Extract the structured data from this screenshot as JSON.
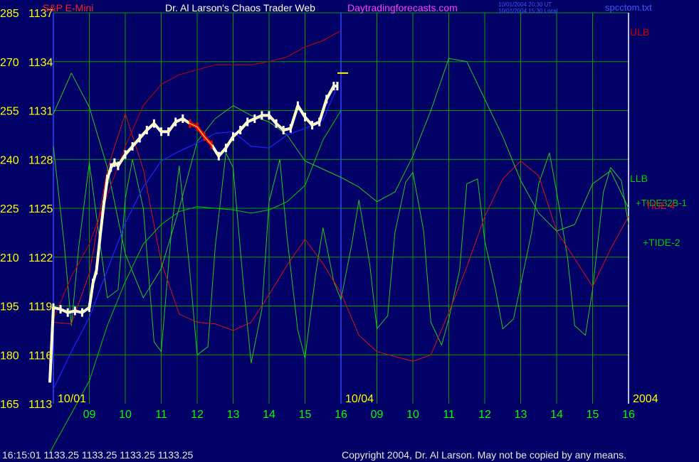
{
  "header": {
    "instrument": "S&P E-Mini",
    "site_title": "Dr. Al Larson's Chaos Trader Web",
    "site_url": "Daytradingforecasts.com",
    "ut_time": "10/01/2004 20:30 UT",
    "local_time": "10/01/2004 15:30 Local",
    "file_name": "spcctom.txt"
  },
  "footer": {
    "quote": "16:15:01  1133.25 1133.25 1133.25 1133.25",
    "copyright": "Copyright 2004, Dr. Al Larson. May not be copied by any means."
  },
  "colors": {
    "background": "#000066",
    "grid": "#00a000",
    "axis_text": "#ffff00",
    "time_text": "#00ff00",
    "price_bars": "#ffffff",
    "red_bars": "#ff0000",
    "ulb": "#cc0000",
    "llb": "#00cc00",
    "tide_red": "#dd1111",
    "tide_green": "#22cc22",
    "moving_avg": "#2222ff"
  },
  "chart_data": {
    "type": "line",
    "title": "S&P E-Mini",
    "y_left_outer": {
      "ticks": [
        165,
        180,
        195,
        210,
        225,
        240,
        255,
        270,
        285
      ]
    },
    "y_left_inner": {
      "ticks": [
        1113,
        1116,
        1119,
        1122,
        1125,
        1128,
        1131,
        1134,
        1137
      ],
      "range": [
        1113,
        1137
      ]
    },
    "x_ticks": [
      "09",
      "10",
      "11",
      "12",
      "13",
      "14",
      "15",
      "16",
      "09",
      "10",
      "11",
      "12",
      "13",
      "14",
      "15",
      "16"
    ],
    "date_labels": [
      {
        "at_index": 0,
        "text": "10/01"
      },
      {
        "at_index": 8,
        "text": "10/04"
      },
      {
        "at_index": 16,
        "text": "2004"
      }
    ],
    "x_range": [
      0,
      16
    ],
    "current_price": 1133.25,
    "price_series": {
      "name": "S&P E-Mini",
      "x": [
        -0.1,
        0,
        0.2,
        0.4,
        0.6,
        0.8,
        1.0,
        1.1,
        1.2,
        1.3,
        1.4,
        1.5,
        1.6,
        1.7,
        1.8,
        2.0,
        2.2,
        2.4,
        2.6,
        2.8,
        3.0,
        3.2,
        3.4,
        3.6,
        3.8,
        4.0,
        4.2,
        4.4,
        4.6,
        4.8,
        5.0,
        5.2,
        5.4,
        5.6,
        5.8,
        6.0,
        6.2,
        6.4,
        6.6,
        6.8,
        7.0,
        7.2,
        7.4,
        7.6,
        7.8,
        7.9
      ],
      "y": [
        1114.3,
        1118.9,
        1118.8,
        1118.6,
        1118.7,
        1118.6,
        1118.9,
        1120.4,
        1121.2,
        1123.3,
        1125.2,
        1126.8,
        1127.5,
        1127.8,
        1127.6,
        1128.3,
        1128.8,
        1129.3,
        1129.8,
        1130.2,
        1129.7,
        1129.7,
        1130.3,
        1130.5,
        1130.2,
        1130.0,
        1129.4,
        1128.9,
        1128.2,
        1128.7,
        1129.4,
        1129.8,
        1130.3,
        1130.5,
        1130.7,
        1130.7,
        1130.2,
        1129.8,
        1129.9,
        1131.3,
        1130.6,
        1130.1,
        1130.3,
        1131.7,
        1132.5,
        1132.5
      ]
    },
    "red_segment_x": [
      3.7,
      4.4
    ],
    "forecast_stub": {
      "x": [
        7.9,
        8.2
      ],
      "y": [
        1133.3,
        1133.3
      ]
    },
    "ulb": {
      "name": "ULB",
      "x": [
        0,
        0.5,
        1.0,
        1.5,
        2.0,
        2.5,
        3.0,
        3.5,
        4.0,
        4.5,
        5.0,
        5.5,
        6.0,
        6.5,
        7.0,
        7.5,
        8.0
      ],
      "y": [
        1118.2,
        1120.8,
        1122.8,
        1125.8,
        1128.8,
        1131.3,
        1132.6,
        1133.2,
        1133.5,
        1133.8,
        1133.8,
        1133.8,
        1134.0,
        1134.3,
        1134.9,
        1135.3,
        1135.9
      ]
    },
    "llb": {
      "name": "LLB",
      "x": [
        -0.1,
        0.5,
        1.0,
        1.5,
        2.0,
        2.5,
        3.0,
        3.5,
        4.0,
        4.5,
        5.0,
        5.5,
        6.0,
        6.5,
        7.0,
        7.5,
        8.0
      ],
      "y": [
        1110.0,
        1112.4,
        1114.4,
        1117.8,
        1120.5,
        1122.8,
        1124.0,
        1124.8,
        1125.1,
        1125.0,
        1124.9,
        1124.7,
        1124.9,
        1125.4,
        1126.4,
        1129.2,
        1131.0
      ]
    },
    "moving_average": {
      "x": [
        0,
        0.5,
        1.0,
        1.5,
        2.0,
        2.5,
        3.0,
        3.5,
        4.0,
        4.5,
        5.0,
        5.5,
        6.0,
        6.5,
        7.0,
        7.5,
        7.9
      ],
      "y": [
        1113.9,
        1116.2,
        1118.3,
        1121.2,
        1124.1,
        1126.3,
        1127.9,
        1128.5,
        1129.0,
        1129.6,
        1129.7,
        1128.8,
        1128.7,
        1129.5,
        1129.9,
        1130.4,
        1132.5
      ]
    },
    "tide_32b1": {
      "name": "TIDE-32B-1",
      "x": [
        0,
        0.5,
        1.0,
        1.5,
        2.0,
        2.5,
        3.0,
        3.5,
        4.0,
        4.5,
        5.0,
        5.5,
        6.0,
        6.5,
        7.0,
        7.5,
        8.0,
        8.5,
        9.0,
        9.5,
        10.0,
        10.5,
        11.0,
        11.5,
        12.0,
        12.5,
        13.0,
        13.5,
        14.0,
        14.5,
        15.0,
        15.5,
        16.0
      ],
      "y": [
        1130.8,
        1133.3,
        1131.2,
        1127.5,
        1122.2,
        1119.5,
        1121.3,
        1125.0,
        1129.1,
        1130.5,
        1131.3,
        1130.7,
        1130.3,
        1129.5,
        1127.9,
        1127.4,
        1126.9,
        1126.3,
        1125.4,
        1126.0,
        1128.2,
        1131.0,
        1134.2,
        1134.0,
        1131.7,
        1129.4,
        1126.7,
        1124.7,
        1123.6,
        1124.0,
        1126.5,
        1127.3,
        1125.0
      ]
    },
    "tide_red": {
      "name": "TIDE-4",
      "x": [
        0,
        0.5,
        1.0,
        1.5,
        2.0,
        2.5,
        3.0,
        3.5,
        4.0,
        4.5,
        5.0,
        5.5,
        6.0,
        6.5,
        7.0,
        7.5,
        8.0,
        8.5,
        9.0,
        9.5,
        10.0,
        10.5,
        11.0,
        11.5,
        12.0,
        12.5,
        13.0,
        13.5,
        14.0,
        14.5,
        15.0,
        15.5,
        16.0
      ],
      "y": [
        1118.0,
        1117.9,
        1121.0,
        1127.4,
        1130.8,
        1127.4,
        1121.7,
        1118.5,
        1118.0,
        1117.9,
        1117.5,
        1118.0,
        1119.7,
        1121.5,
        1123.1,
        1121.6,
        1119.8,
        1117.2,
        1116.2,
        1115.9,
        1115.6,
        1116.0,
        1118.6,
        1121.4,
        1124.5,
        1126.8,
        1127.9,
        1127.0,
        1123.6,
        1121.9,
        1120.2,
        1122.5,
        1124.5
      ]
    },
    "tide_2": {
      "name": "TIDE-2",
      "x": [
        0,
        0.3,
        0.5,
        0.7,
        1.0,
        1.2,
        1.5,
        1.8,
        2.0,
        2.2,
        2.5,
        2.8,
        3.0,
        3.3,
        3.5,
        3.8,
        4.0,
        4.3,
        4.5,
        4.8,
        5.0,
        5.3,
        5.5,
        5.8,
        6.0,
        6.3,
        6.5,
        6.8,
        7.0,
        7.3,
        7.5,
        7.8,
        8.0,
        8.3,
        8.5,
        8.8,
        9.0,
        9.3,
        9.5,
        9.8,
        10.0,
        10.3,
        10.5,
        10.8,
        11.0,
        11.3,
        11.5,
        11.8,
        12.0,
        12.3,
        12.5,
        12.8,
        13.0,
        13.3,
        13.5,
        13.8,
        14.0,
        14.3,
        14.5,
        14.8,
        15.0,
        15.3,
        15.5,
        15.8,
        16.0
      ],
      "y": [
        1128.8,
        1122.8,
        1117.8,
        1122.5,
        1127.8,
        1124.5,
        1119.5,
        1120.0,
        1125.6,
        1128.0,
        1125.0,
        1116.8,
        1116.2,
        1124.0,
        1127.6,
        1121.0,
        1116.0,
        1116.5,
        1122.6,
        1128.4,
        1127.5,
        1120.0,
        1115.5,
        1118.8,
        1125.4,
        1128.0,
        1123.2,
        1117.5,
        1115.8,
        1121.0,
        1123.8,
        1120.5,
        1119.4,
        1122.8,
        1125.5,
        1121.6,
        1117.6,
        1118.4,
        1123.5,
        1126.6,
        1127.2,
        1123.6,
        1118.0,
        1116.6,
        1118.2,
        1121.2,
        1126.5,
        1126.8,
        1123.0,
        1120.0,
        1117.6,
        1118.2,
        1120.3,
        1123.5,
        1126.5,
        1128.4,
        1126.0,
        1122.0,
        1117.8,
        1117.2,
        1120.0,
        1126.0,
        1127.5,
        1126.7,
        1124.0
      ]
    },
    "right_labels": [
      "ULB",
      "LLB",
      "+TIDE32B-1",
      "TIDE-4",
      "+TIDE-2"
    ]
  }
}
